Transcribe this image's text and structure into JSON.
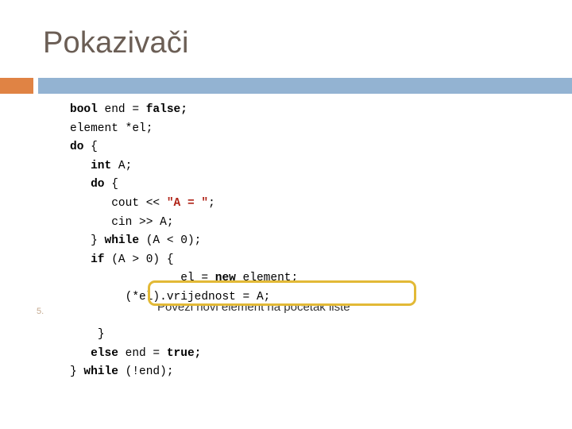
{
  "slide": {
    "title": "Pokazivači",
    "bullet_number": "5.",
    "colors": {
      "title": "#6b5e55",
      "bar_orange": "#e08344",
      "bar_blue": "#93b3d2",
      "highlight_border": "#e2b936",
      "string_literal": "#b02418",
      "bullet_number": "#c4a98f"
    }
  },
  "code": {
    "language": "cpp",
    "lines": [
      {
        "indent": 0,
        "segments": [
          {
            "t": "bool",
            "bold": true
          },
          {
            "t": " end = "
          },
          {
            "t": "false;",
            "bold": true
          }
        ]
      },
      {
        "indent": 0,
        "segments": [
          {
            "t": "element *el;"
          }
        ]
      },
      {
        "indent": 0,
        "segments": [
          {
            "t": "do",
            "bold": true
          },
          {
            "t": " {"
          }
        ]
      },
      {
        "indent": 3,
        "segments": [
          {
            "t": "int",
            "bold": true
          },
          {
            "t": " A;"
          }
        ]
      },
      {
        "indent": 3,
        "segments": [
          {
            "t": "do",
            "bold": true
          },
          {
            "t": " {"
          }
        ]
      },
      {
        "indent": 6,
        "segments": [
          {
            "t": "cout << "
          },
          {
            "t": "\"A = \"",
            "str": true
          },
          {
            "t": ";"
          }
        ]
      },
      {
        "indent": 6,
        "segments": [
          {
            "t": "cin >> A;"
          }
        ]
      },
      {
        "indent": 3,
        "segments": [
          {
            "t": "} "
          },
          {
            "t": "while",
            "bold": true
          },
          {
            "t": " (A < 0);"
          }
        ]
      },
      {
        "indent": 3,
        "segments": [
          {
            "t": "if",
            "bold": true
          },
          {
            "t": " (A > 0) {"
          }
        ]
      },
      {
        "indent": 16,
        "segments": [
          {
            "t": "el = "
          },
          {
            "t": "new",
            "bold": true
          },
          {
            "t": " element;"
          }
        ]
      },
      {
        "indent": 8,
        "segments": [
          {
            "t": "(*el).vrijednost = A;"
          }
        ]
      },
      {
        "indent": 0,
        "segments": [
          {
            "t": ""
          }
        ]
      },
      {
        "indent": 4,
        "segments": [
          {
            "t": "}"
          }
        ]
      },
      {
        "indent": 3,
        "segments": [
          {
            "t": "else",
            "bold": true
          },
          {
            "t": " end = "
          },
          {
            "t": "true;",
            "bold": true
          }
        ]
      },
      {
        "indent": 0,
        "segments": [
          {
            "t": "} "
          },
          {
            "t": "while",
            "bold": true
          },
          {
            "t": " (!end);"
          }
        ]
      }
    ]
  },
  "annotation": {
    "comment": "Poveži novi element na početak liste",
    "box_label": "highlight-rectangle"
  }
}
